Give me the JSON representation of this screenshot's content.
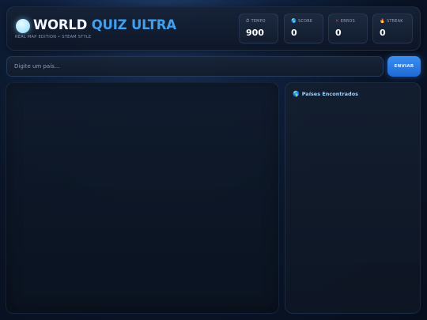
{
  "header": {
    "title_part1": "WORLD ",
    "title_part2": "QUIZ ULTRA",
    "subtitle": "REAL MAP EDITION • STEAM STYLE",
    "logo_icon": "globe-dot-icon"
  },
  "stats": [
    {
      "id": "tempo",
      "icon": "⏱",
      "icon_name": "timer-icon",
      "icon_color": "#9fb0c8",
      "label": "TEMPO",
      "value": "900"
    },
    {
      "id": "score",
      "icon": "🌎",
      "icon_name": "globe-icon",
      "icon_color": "#4fa8f0",
      "label": "SCORE",
      "value": "0"
    },
    {
      "id": "erros",
      "icon": "✕",
      "icon_name": "cross-icon",
      "icon_color": "#e0404a",
      "label": "ERROS",
      "value": "0"
    },
    {
      "id": "streak",
      "icon": "🔥",
      "icon_name": "fire-icon",
      "icon_color": "#f08a24",
      "label": "STREAK",
      "value": "0"
    }
  ],
  "search": {
    "placeholder": "Digite um país...",
    "value": "",
    "submit_label": "ENVIAR"
  },
  "found_panel": {
    "icon": "🌎",
    "icon_name": "globe-icon",
    "title": "Países Encontrados",
    "items": []
  },
  "colors": {
    "accent": "#3fa0f0",
    "button": "#2a7de8",
    "background": "#0a1528"
  }
}
